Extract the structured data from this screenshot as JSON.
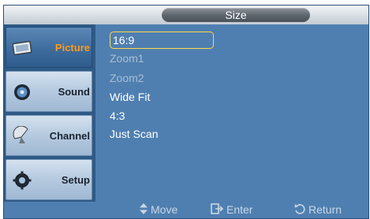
{
  "title": "Size",
  "sidebar": {
    "items": [
      {
        "label": "Picture",
        "icon": "picture-icon",
        "active": true
      },
      {
        "label": "Sound",
        "icon": "sound-icon",
        "active": false
      },
      {
        "label": "Channel",
        "icon": "channel-icon",
        "active": false
      },
      {
        "label": "Setup",
        "icon": "setup-icon",
        "active": false
      }
    ]
  },
  "options": [
    {
      "label": "16:9",
      "state": "selected"
    },
    {
      "label": "Zoom1",
      "state": "disabled"
    },
    {
      "label": "Zoom2",
      "state": "disabled"
    },
    {
      "label": "Wide Fit",
      "state": "normal"
    },
    {
      "label": "4:3",
      "state": "normal"
    },
    {
      "label": "Just Scan",
      "state": "normal"
    }
  ],
  "footer": {
    "move": "Move",
    "enter": "Enter",
    "return": "Return"
  },
  "colors": {
    "background": "#4f7fb0",
    "active_label": "#ff9a1e",
    "selection_border": "#ffd84a",
    "disabled_text": "#a9bed3"
  }
}
